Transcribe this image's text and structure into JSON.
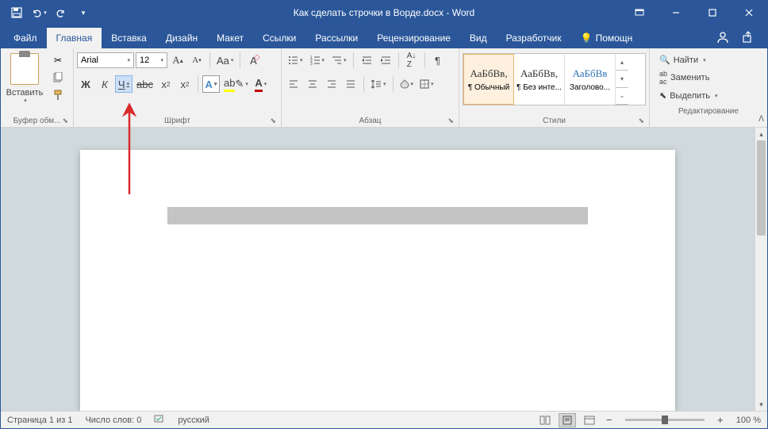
{
  "title": "Как сделать строчки в Ворде.docx - Word",
  "tabs": [
    "Файл",
    "Главная",
    "Вставка",
    "Дизайн",
    "Макет",
    "Ссылки",
    "Рассылки",
    "Рецензирование",
    "Вид",
    "Разработчик"
  ],
  "tellme": "Помощн",
  "activeTab": 1,
  "clipboard": {
    "paste": "Вставить",
    "group": "Буфер обм..."
  },
  "font": {
    "name": "Arial",
    "size": "12",
    "group": "Шрифт",
    "bold": "Ж",
    "italic": "К",
    "underline": "Ч",
    "strike": "abc"
  },
  "paragraph": {
    "group": "Абзац"
  },
  "styles": {
    "group": "Стили",
    "items": [
      {
        "preview": "АаБбВв,",
        "name": "¶ Обычный"
      },
      {
        "preview": "АаБбВв,",
        "name": "¶ Без инте..."
      },
      {
        "preview": "АаБбВв",
        "name": "Заголово..."
      }
    ]
  },
  "editing": {
    "group": "Редактирование",
    "find": "Найти",
    "replace": "Заменить",
    "select": "Выделить"
  },
  "status": {
    "page": "Страница 1 из 1",
    "words": "Число слов: 0",
    "lang": "русский",
    "zoom": "100 %"
  }
}
